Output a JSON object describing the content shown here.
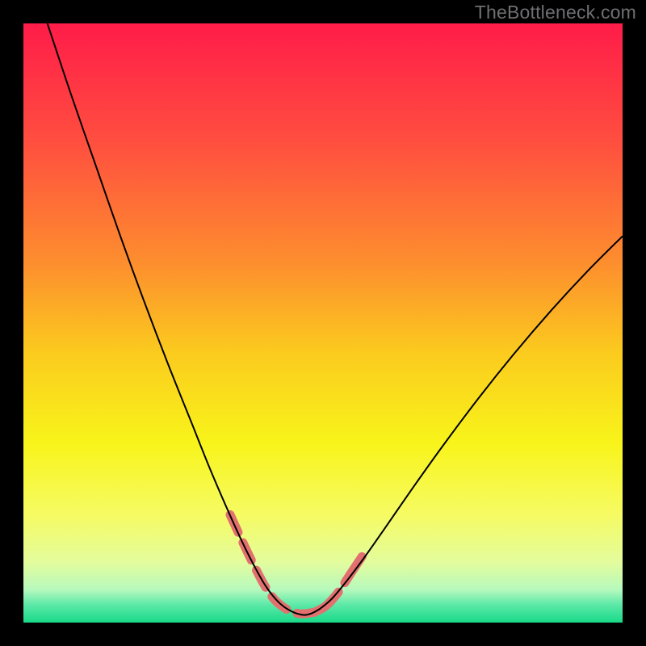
{
  "watermark": "TheBottleneck.com",
  "chart_data": {
    "type": "line",
    "title": "",
    "xlabel": "",
    "ylabel": "",
    "x_range": [
      0,
      100
    ],
    "y_range": [
      0,
      100
    ],
    "background": {
      "type": "vertical_gradient",
      "stops": [
        {
          "offset": 0.0,
          "color": "#ff1c49"
        },
        {
          "offset": 0.2,
          "color": "#ff4f3f"
        },
        {
          "offset": 0.4,
          "color": "#fd8e2e"
        },
        {
          "offset": 0.55,
          "color": "#fbcb1e"
        },
        {
          "offset": 0.7,
          "color": "#f8f41a"
        },
        {
          "offset": 0.82,
          "color": "#f6fb63"
        },
        {
          "offset": 0.9,
          "color": "#e3fc9d"
        },
        {
          "offset": 0.945,
          "color": "#b6f9bd"
        },
        {
          "offset": 0.97,
          "color": "#5de9a8"
        },
        {
          "offset": 1.0,
          "color": "#18d989"
        }
      ]
    },
    "series": [
      {
        "name": "curve-left",
        "stroke": "#000000",
        "stroke_width": 2,
        "points": [
          {
            "x": 4.0,
            "y": 100.0
          },
          {
            "x": 8.0,
            "y": 88.0
          },
          {
            "x": 12.0,
            "y": 76.5
          },
          {
            "x": 16.0,
            "y": 65.0
          },
          {
            "x": 20.0,
            "y": 54.0
          },
          {
            "x": 24.0,
            "y": 43.5
          },
          {
            "x": 28.0,
            "y": 33.5
          },
          {
            "x": 31.0,
            "y": 26.0
          },
          {
            "x": 34.0,
            "y": 19.0
          },
          {
            "x": 36.5,
            "y": 13.5
          },
          {
            "x": 38.5,
            "y": 9.5
          },
          {
            "x": 40.5,
            "y": 6.0
          },
          {
            "x": 42.5,
            "y": 3.5
          },
          {
            "x": 44.5,
            "y": 2.0
          },
          {
            "x": 46.5,
            "y": 1.3
          },
          {
            "x": 48.0,
            "y": 1.5
          },
          {
            "x": 49.5,
            "y": 2.3
          }
        ]
      },
      {
        "name": "curve-right",
        "stroke": "#000000",
        "stroke_width": 2,
        "points": [
          {
            "x": 49.5,
            "y": 2.3
          },
          {
            "x": 51.5,
            "y": 4.0
          },
          {
            "x": 54.0,
            "y": 7.0
          },
          {
            "x": 57.0,
            "y": 11.0
          },
          {
            "x": 60.5,
            "y": 16.0
          },
          {
            "x": 65.0,
            "y": 22.5
          },
          {
            "x": 70.0,
            "y": 29.5
          },
          {
            "x": 76.0,
            "y": 37.5
          },
          {
            "x": 82.0,
            "y": 45.0
          },
          {
            "x": 88.0,
            "y": 52.0
          },
          {
            "x": 94.0,
            "y": 58.5
          },
          {
            "x": 100.0,
            "y": 64.5
          }
        ]
      },
      {
        "name": "highlight-left",
        "stroke": "#e2706e",
        "stroke_width": 11,
        "linecap": "round",
        "dash": [
          24,
          14
        ],
        "points": [
          {
            "x": 34.5,
            "y": 18.0
          },
          {
            "x": 38.0,
            "y": 10.5
          },
          {
            "x": 41.0,
            "y": 5.0
          },
          {
            "x": 43.5,
            "y": 2.5
          },
          {
            "x": 46.0,
            "y": 1.5
          },
          {
            "x": 48.5,
            "y": 1.7
          }
        ]
      },
      {
        "name": "highlight-right",
        "stroke": "#e2706e",
        "stroke_width": 11,
        "linecap": "round",
        "dash": [
          40,
          14
        ],
        "points": [
          {
            "x": 48.5,
            "y": 1.7
          },
          {
            "x": 50.5,
            "y": 2.8
          },
          {
            "x": 52.5,
            "y": 5.0
          },
          {
            "x": 54.5,
            "y": 8.0
          },
          {
            "x": 56.5,
            "y": 11.0
          }
        ]
      }
    ]
  }
}
